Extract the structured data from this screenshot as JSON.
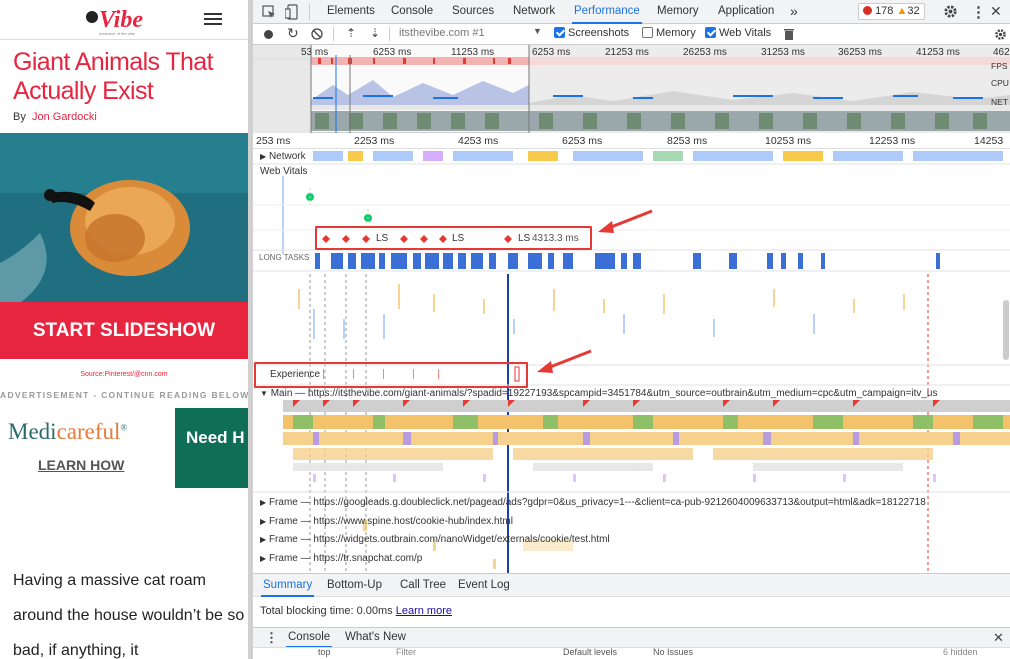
{
  "site": {
    "logo_text": "Vibe",
    "title": "Giant Animals That Actually Exist",
    "byline_prefix": "By",
    "author": "Jon Gardocki",
    "slideshow_button": "START SLIDESHOW",
    "source": "Source:Pinterest/@cnn.com",
    "advertisement": "ADVERTISEMENT - CONTINUE READING BELOW",
    "ad_brand_1": "Medi",
    "ad_brand_2": "careful",
    "ad_learn": "LEARN HOW",
    "ad_box_text": "Need H",
    "body_text": "Having a massive cat roam around the house wouldn’t be so bad, if anything, it"
  },
  "devtools": {
    "tabs": [
      "Elements",
      "Console",
      "Sources",
      "Network",
      "Performance",
      "Memory",
      "Application"
    ],
    "active_tab": "Performance",
    "more_tabs": "»",
    "errors": "178",
    "warnings": "32",
    "toolbar": {
      "url": "itsthevibe.com #1",
      "screenshots_label": "Screenshots",
      "memory_label": "Memory",
      "web_vitals_label": "Web Vitals"
    },
    "overview": {
      "ticks": [
        "53 ms",
        "6253 ms",
        "11253 ms",
        "6253 ms",
        "21253 ms",
        "26253 ms",
        "31253 ms",
        "36253 ms",
        "41253 ms",
        "4625"
      ],
      "fps": "FPS",
      "cpu": "CPU",
      "net": "NET"
    },
    "ruler": [
      "253 ms",
      "2253 ms",
      "4253 ms",
      "6253 ms",
      "8253 ms",
      "10253 ms",
      "12253 ms",
      "14253"
    ],
    "tracks": {
      "network": "Network",
      "web_vitals": "Web Vitals",
      "ls_label": "LS",
      "ls_time": "4313.3 ms",
      "long_tasks": "LONG TASKS",
      "experience": "Experience",
      "main": "Main — https://itsthevibe.com/giant-animals/?spadid=19227193&spcampid=3451784&utm_source=outbrain&utm_medium=cpc&utm_campaign=itv_us"
    },
    "frames": [
      "Frame — https://googleads.g.doubleclick.net/pagead/ads?gdpr=0&us_privacy=1---&client=ca-pub-9212604009633713&output=html&adk=18122718",
      "Frame — https://www.spine.host/cookie-hub/index.html",
      "Frame — https://widgets.outbrain.com/nanoWidget/externals/cookie/test.html",
      "Frame — https://tr.snapchat.com/p"
    ],
    "summary_tabs": [
      "Summary",
      "Bottom-Up",
      "Call Tree",
      "Event Log"
    ],
    "total_blocking": "Total blocking time: 0.00ms",
    "learn_more": "Learn more",
    "console_tabs": [
      "Console",
      "What's New"
    ],
    "console_bar": {
      "context": "top",
      "filter": "Filter",
      "levels": "Default levels",
      "issues": "No Issues",
      "hidden": "6 hidden"
    }
  }
}
